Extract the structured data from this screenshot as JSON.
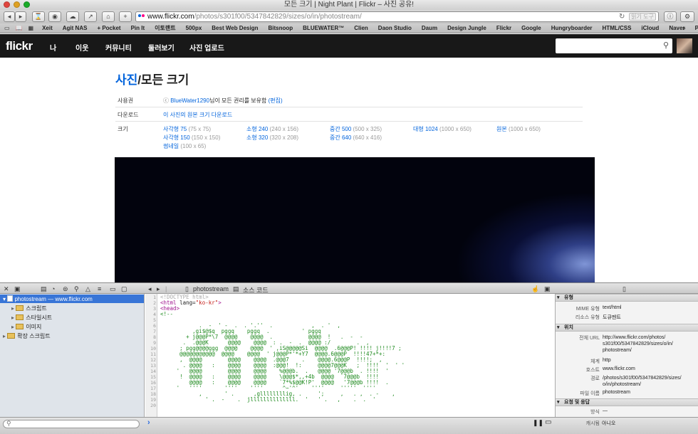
{
  "window": {
    "title": "모든 크기 | Night Plant | Flickr – 사진 공유!"
  },
  "toolbar": {
    "url_host": "www.flickr.com",
    "url_path": "/photos/s301f00/5347842829/sizes/o/in/photostream/",
    "reader_label": "읽기 도구"
  },
  "bookmarks": [
    "Xeit",
    "Agit NAS",
    "+ Pocket",
    "Pin It",
    "이토랜트",
    "500px",
    "Best Web Design",
    "Bitsnoop",
    "BLUEWATER™",
    "Clien",
    "Daon Studio",
    "Daum",
    "Design Jungle",
    "Flickr",
    "Google",
    "Hungryboarder",
    "HTML/CSS",
    "iCloud",
    "Naver",
    "Parkoz"
  ],
  "nav": {
    "logo": "flickr",
    "items": [
      "나",
      "이웃",
      "커뮤니티",
      "둘러보기",
      "사진 업로드"
    ]
  },
  "page": {
    "title_link": "사진",
    "title_rest": "/모든 크기",
    "license_label": "사용권",
    "license_symbol": "ⓒ",
    "license_owner": "BlueWater1290",
    "license_text": "님이 모든 권리를 보유함",
    "license_edit": "(편집)",
    "download_label": "다운로드",
    "download_link": "이 사진의 원본 크기 다운로드",
    "sizes_label": "크기",
    "sizes": [
      {
        "name": "사각형 75",
        "dim": "(75 x 75)"
      },
      {
        "name": "사각형 150",
        "dim": "(150 x 150)"
      },
      {
        "name": "썸네일",
        "dim": "(100 x 65)"
      },
      {
        "name": "소형 240",
        "dim": "(240 x 156)"
      },
      {
        "name": "소형 320",
        "dim": "(320 x 208)"
      },
      {
        "name": "중간 500",
        "dim": "(500 x 325)"
      },
      {
        "name": "중간 640",
        "dim": "(640 x 416)"
      },
      {
        "name": "대형 1024",
        "dim": "(1000 x 650)"
      },
      {
        "name": "원본",
        "dim": "(1000 x 650)"
      }
    ]
  },
  "inspector": {
    "breadcrumb_page": "photostream",
    "breadcrumb_view": "소스 코드",
    "tree": [
      {
        "label": "photostream — www.flickr.com"
      },
      {
        "label": "스크립트"
      },
      {
        "label": "스타일시트"
      },
      {
        "label": "이미지"
      },
      {
        "label": "확장 스크립트"
      }
    ],
    "line_numbers": [
      "1",
      "2",
      "3",
      "4",
      "5",
      "6",
      "7",
      "8",
      "9",
      "10",
      "11",
      "12",
      "13",
      "14",
      "15",
      "16",
      "17",
      "18",
      "19",
      "20"
    ],
    "code_doctype": "<!DOCTYPE html>",
    "code_html_open": "<html",
    "code_attr": " lang=",
    "code_lang_val": "\"ko-kr\"",
    "code_html_close": ">",
    "code_head": "<head>",
    "code_comment_open": "<!--",
    "ascii_lines": [
      "",
      "            .  -  ' -  .  . '.''  .            ,  . '  ,",
      "          ,gi$@$q  pggq    pggq  .          ' pggq",
      "        + j@@@P*\\7  @@@@    @@@@  .           @@@@  !   .  -  -",
      "       .  .@@@K      @@@@    @@@@  : .  -  .  @@@@ :/        .  ,",
      "      ; pgg@@@@ggg  @@@@    @@@@  ' ,iS@@@@@Si  @@@@  .6@@@P! !!!! j!!!!7 ;",
      "      @@@@@@@@@@@  @@@@    @@@@  ' j@@@P*'*+Y7  @@@@.6@@@P  !!!!47+*+:",
      "      ,  @@@@        @@@@    @@@@  .@@@7    .    @@@@.6@@@P  !!!!;  ,",
      "       . @@@@   :    @@@@    @@@@  :@@@!  !:     @@@@7@@@K   ;  !!!!  '  ' '",
      "     '   @@@@        @@@@    @@@@    %@@@b.  .   @@@@ '7@@@b  . !!!!  '",
      "      !  @@@@   :    @@@@    @@@@    \\@@@$*,,+4b  @@@@  `7@@@b  !!!!",
      "         @@@@   :    @@@@    @@@@    `7*%$@@K!P'  @@@@   '7@@@b !!!!  .",
      "     '   ''''       ''''    ''''      ^~'^'    ''''     '''''  ''''",
      "            ,       ' .      ,gllllllllig, .     ';     ,   . ,  . -    ,",
      "              ' .  -    .  jllllllllllllll.  '   ' .   ,    .  .  '"
    ],
    "right": {
      "type_header": "유형",
      "mime_label": "MIME 유형",
      "mime_value": "text/html",
      "resource_label": "리소스 유형",
      "resource_value": "도큐멘트",
      "location_header": "위치",
      "fullurl_label": "전체 URL",
      "fullurl_value": "http://www.flickr.com/photos/\ns301f00/5347842829/sizes/o/in/\nphotostream/",
      "scheme_label": "체계",
      "scheme_value": "http",
      "host_label": "호스트",
      "host_value": "www.flickr.com",
      "path_label": "경로",
      "path_value": "/photos/s301f00/5347842829/sizes/\no/in/photostream/",
      "filename_label": "파일 이름",
      "filename_value": "photostream",
      "request_header": "요청 및 응답",
      "method_label": "방식",
      "method_value": "—",
      "cached_label": "캐시됨",
      "cached_value": "아니오"
    },
    "console_prompt": "›"
  },
  "colors": {
    "accent": "#0063dc",
    "nav_bg": "#181818",
    "selection": "#3875d7"
  }
}
